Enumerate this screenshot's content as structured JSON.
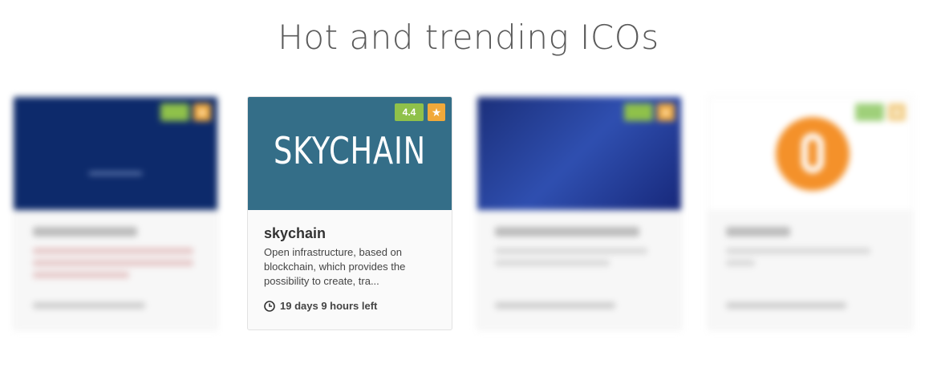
{
  "page": {
    "title": "Hot and trending ICOs"
  },
  "cards": [
    {
      "name": "blurred-card",
      "rating": "",
      "description": "",
      "time_left": ""
    },
    {
      "name": "skychain",
      "banner_text": "SKYCHAIN",
      "rating": "4.4",
      "description": "Open infrastructure, based on blockchain, which provides the possibility to create, tra...",
      "time_left": "19 days 9 hours left",
      "banner_color": "#346e88"
    },
    {
      "name": "blurred-card",
      "rating": "",
      "description": "",
      "time_left": ""
    },
    {
      "name": "blurred-card",
      "rating": "",
      "description": "",
      "time_left": ""
    }
  ],
  "icons": {
    "star": "star-icon",
    "clock": "clock-icon"
  },
  "colors": {
    "rating_badge": "#8fc14a",
    "star_badge": "#f1a93a",
    "orange_logo": "#f4912a"
  }
}
